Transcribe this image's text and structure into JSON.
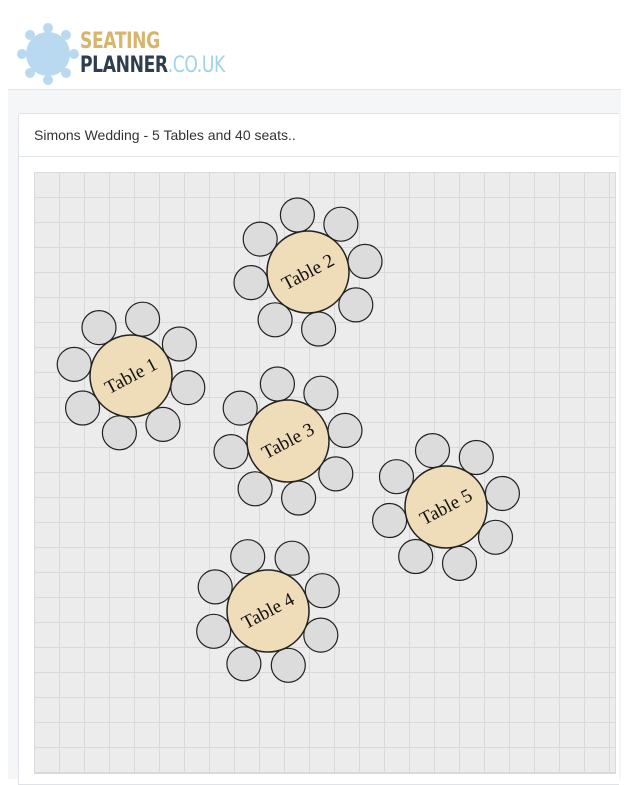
{
  "logo": {
    "line1": "SEATING",
    "line2_main": "PLANNER",
    "line2_suffix": ".CO.UK",
    "colors": {
      "gold": "#d7b56d",
      "dark": "#2f3e4d",
      "light_blue": "#9fd3ea"
    }
  },
  "panel": {
    "title": "Simons Wedding - 5 Tables and 40 seats.."
  },
  "floor_plan": {
    "table_color": "#efdcb9",
    "seat_color": "#dcdcdc",
    "tables": [
      {
        "label": "Table 1",
        "seats": 8
      },
      {
        "label": "Table 2",
        "seats": 8
      },
      {
        "label": "Table 3",
        "seats": 8
      },
      {
        "label": "Table 4",
        "seats": 8
      },
      {
        "label": "Table 5",
        "seats": 8
      }
    ]
  }
}
